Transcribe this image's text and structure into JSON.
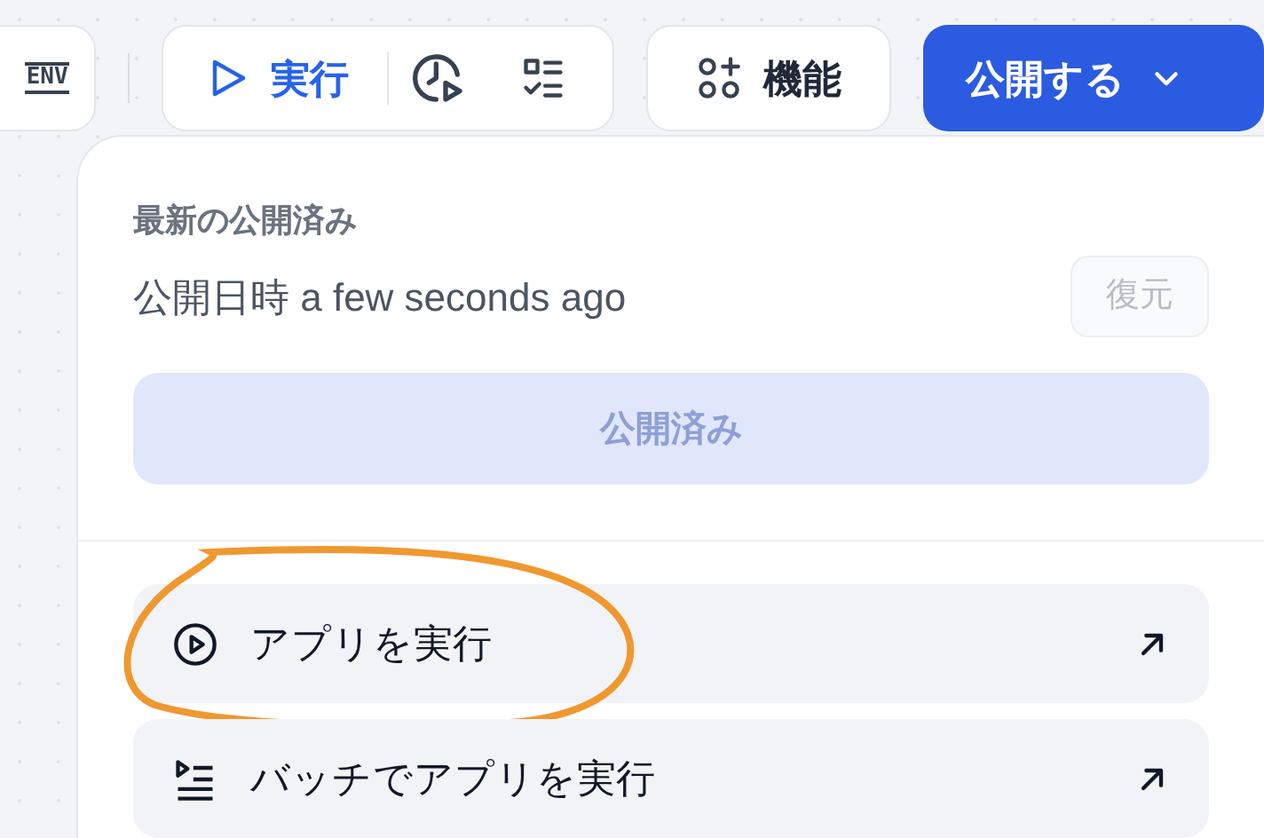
{
  "toolbar": {
    "env_button": {
      "label": "ENV"
    },
    "run_button": {
      "label": "実行"
    },
    "features_button": {
      "label": "機能"
    },
    "publish_button": {
      "label": "公開する"
    }
  },
  "publish_panel": {
    "section_title": "最新の公開済み",
    "published_time": "公開日時 a few seconds ago",
    "restore_button": {
      "label": "復元",
      "disabled": true
    },
    "published_button": {
      "label": "公開済み",
      "disabled": true
    },
    "actions": [
      {
        "kind": "run",
        "label": "アプリを実行",
        "highlighted": true
      },
      {
        "kind": "batch",
        "label": "バッチでアプリを実行",
        "highlighted": false
      }
    ]
  }
}
